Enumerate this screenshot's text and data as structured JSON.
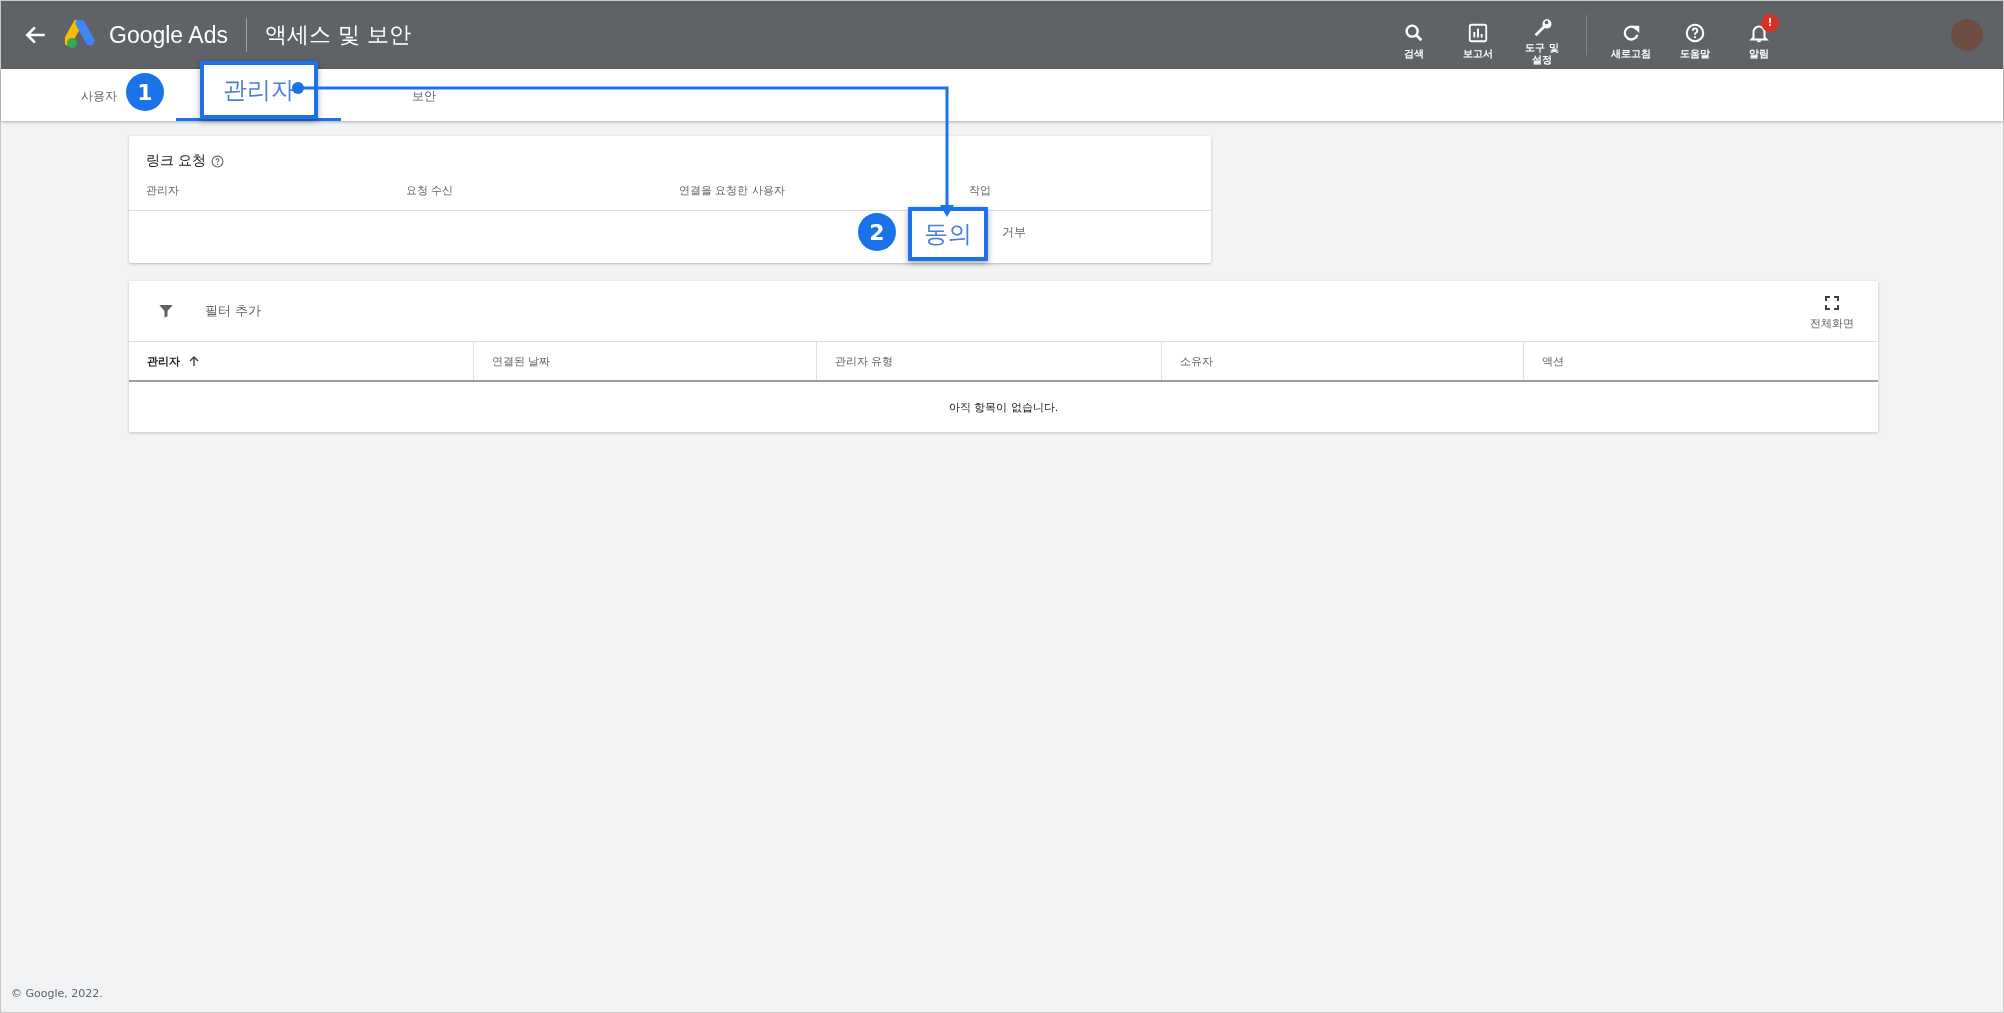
{
  "header": {
    "product": "Google Ads",
    "page_title": "액세스 및 보안",
    "actions": [
      {
        "label": "검색",
        "kind": "search",
        "separated": false
      },
      {
        "label": "보고서",
        "kind": "report",
        "separated": false
      },
      {
        "label": "도구 및 설정",
        "kind": "tools",
        "separated": false
      },
      {
        "label": "새로고침",
        "kind": "refresh",
        "separated": true
      },
      {
        "label": "도움말",
        "kind": "help",
        "separated": false
      },
      {
        "label": "알림",
        "kind": "bell",
        "separated": false,
        "badge": "!"
      }
    ]
  },
  "tabs": [
    {
      "label": "사용자",
      "selected": false
    },
    {
      "label": "관리자",
      "selected": true,
      "callout": "1"
    },
    {
      "label": "보안",
      "selected": false
    }
  ],
  "link_requests": {
    "title": "링크 요청",
    "columns": [
      "관리자",
      "요청 수신",
      "연결을 요청한 사용자",
      "작업"
    ],
    "actions": [
      {
        "label": "동의",
        "callout": "2"
      },
      {
        "label": "거부"
      }
    ]
  },
  "managers": {
    "filter_label": "필터 추가",
    "fullscreen_label": "전체화면",
    "columns": [
      {
        "label": "관리자",
        "sorted": true
      },
      {
        "label": "연결된 날짜",
        "sorted": false
      },
      {
        "label": "관리자 유형",
        "sorted": false
      },
      {
        "label": "소유자",
        "sorted": false
      },
      {
        "label": "액션",
        "sorted": false
      }
    ],
    "empty_message": "아직 항목이 없습니다."
  },
  "footer": "© Google, 2022."
}
